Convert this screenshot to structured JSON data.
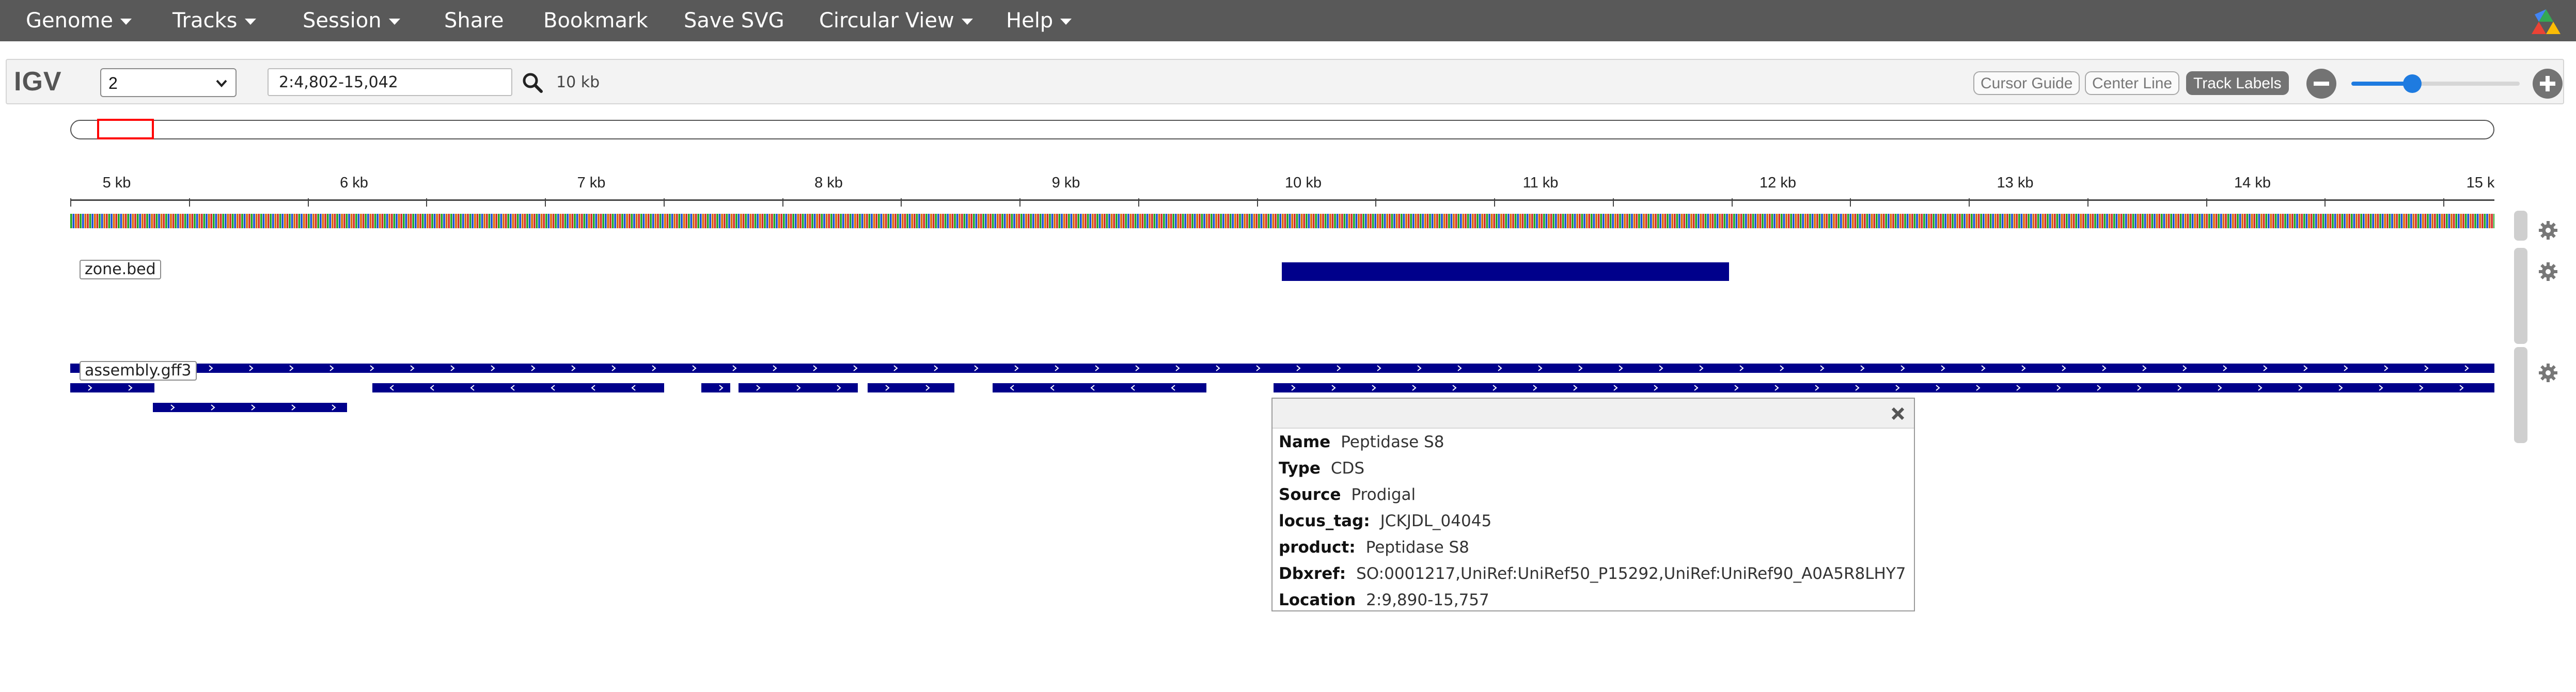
{
  "menu": {
    "genome": "Genome",
    "tracks": "Tracks",
    "session": "Session",
    "share": "Share",
    "bookmark": "Bookmark",
    "save_svg": "Save SVG",
    "circular_view": "Circular View",
    "help": "Help"
  },
  "igv": {
    "logo": "IGV",
    "chromosome": "2",
    "locus": "2:4,802-15,042",
    "window_size": "10 kb",
    "buttons": {
      "cursor_guide": "Cursor Guide",
      "center_line": "Center Line",
      "track_labels": "Track Labels"
    },
    "zoom_level": 0.37
  },
  "ruler": {
    "ticks": [
      "5 kb",
      "6 kb",
      "7 kb",
      "8 kb",
      "9 kb",
      "10 kb",
      "11 kb",
      "12 kb",
      "13 kb",
      "14 kb",
      "15 k"
    ]
  },
  "tracks": {
    "zone_label": "zone.bed",
    "annotation_label": "assembly.gff3"
  },
  "popup": {
    "rows": [
      {
        "key": "Name",
        "value": "Peptidase S8"
      },
      {
        "key": "Type",
        "value": "CDS"
      },
      {
        "key": "Source",
        "value": "Prodigal"
      },
      {
        "key": "locus_tag:",
        "value": "JCKJDL_04045"
      },
      {
        "key": "product:",
        "value": "Peptidase S8"
      },
      {
        "key": "Dbxref:",
        "value": "SO:0001217,UniRef:UniRef50_P15292,UniRef:UniRef90_A0A5R8LHY7"
      },
      {
        "key": "Location",
        "value": "2:9,890-15,757"
      }
    ]
  },
  "colors": {
    "feature": "#00008b",
    "navbar": "#595959",
    "accent": "#1e7be0"
  }
}
